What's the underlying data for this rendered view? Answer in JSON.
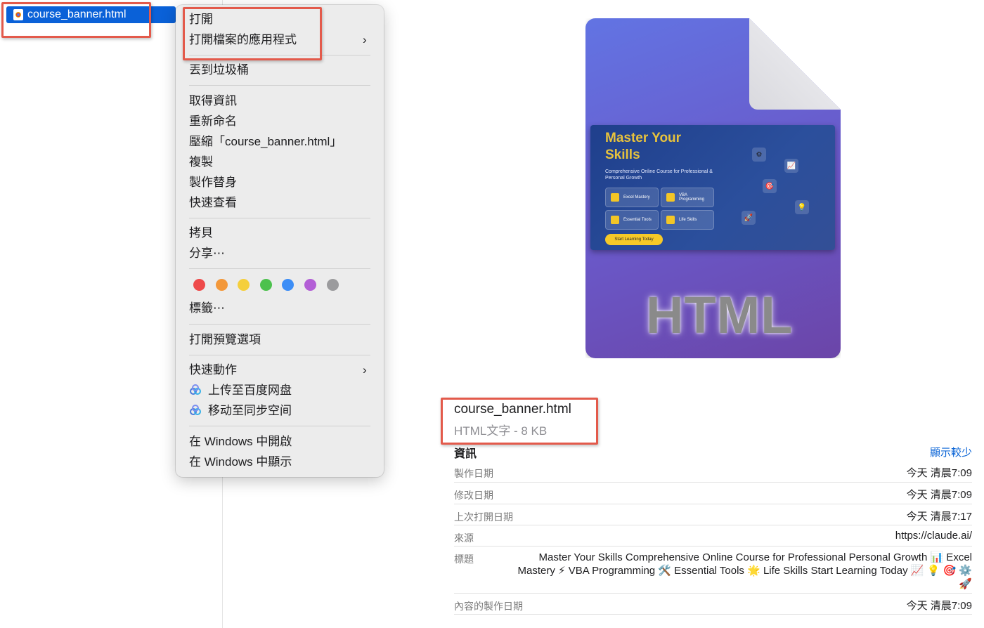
{
  "file_list": {
    "selected_file": "course_banner.html"
  },
  "context_menu": {
    "open": "打開",
    "open_with": "打開檔案的應用程式",
    "move_to_trash": "丟到垃圾桶",
    "get_info": "取得資訊",
    "rename": "重新命名",
    "compress": "壓縮「course_banner.html」",
    "duplicate": "複製",
    "make_alias": "製作替身",
    "quick_look": "快速查看",
    "copy": "拷貝",
    "share": "分享⋯",
    "tags": "標籤⋯",
    "tag_colors": [
      "#ee4a4a",
      "#f3983a",
      "#f5cf3c",
      "#4cc14d",
      "#3d8ef6",
      "#b35fd6",
      "#9b9b9d"
    ],
    "show_view_options": "打開預覽選項",
    "quick_actions": "快速動作",
    "upload_baidu": "上传至百度网盘",
    "move_sync": "移动至同步空间",
    "open_in_windows": "在 Windows 中開啟",
    "show_in_windows": "在 Windows 中顯示"
  },
  "preview": {
    "banner": {
      "title_line1": "Master Your",
      "title_line2": "Skills",
      "subtitle": "Comprehensive Online Course for Professional & Personal Growth",
      "chips": [
        "Excel Mastery",
        "VBA Programming",
        "Essential Tools",
        "Life Skills"
      ],
      "cta": "Start Learning Today"
    },
    "file_type_label": "HTML",
    "file_name": "course_banner.html",
    "file_meta": "HTML文字 - 8 KB"
  },
  "info": {
    "header": "資訊",
    "show_less": "顯示較少",
    "rows": [
      {
        "key": "製作日期",
        "value": "今天 清晨7:09"
      },
      {
        "key": "修改日期",
        "value": "今天 清晨7:09"
      },
      {
        "key": "上次打開日期",
        "value": "今天 清晨7:17"
      },
      {
        "key": "來源",
        "value": "https://claude.ai/"
      },
      {
        "key": "標題",
        "value": "Master Your Skills Comprehensive Online Course for Professional Personal Growth 📊 Excel Mastery ⚡ VBA Programming 🛠️ Essential Tools 🌟 Life Skills Start Learning Today 📈 💡 🎯 ⚙️ 🚀"
      },
      {
        "key": "內容的製作日期",
        "value": "今天 清晨7:09"
      }
    ]
  },
  "colors": {
    "selection": "#0a61d8",
    "annotation_box": "#e35a4b",
    "link": "#0a64d6"
  },
  "icons": [
    "chrome-html-file-icon",
    "chevron-right-icon",
    "baidu-cloud-icon"
  ]
}
